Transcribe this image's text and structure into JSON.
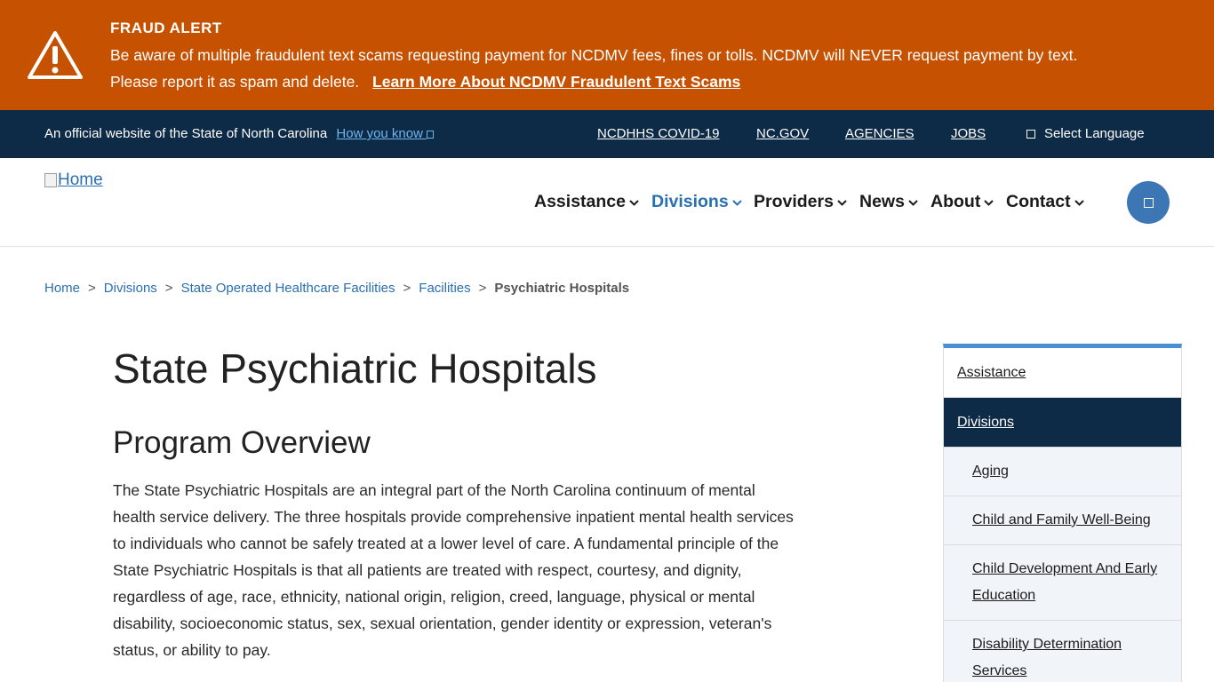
{
  "alert": {
    "title": "FRAUD ALERT",
    "message": "Be aware of multiple fraudulent text scams requesting payment for NCDMV fees, fines or tolls. NCDMV will NEVER request payment by text. Please report it as spam and delete.",
    "link": "Learn More About NCDMV Fraudulent Text Scams"
  },
  "topbar": {
    "official": "An official website of the State of North Carolina",
    "how_you_know": "How you know",
    "links": [
      "NCDHHS COVID-19",
      "NC.GOV",
      "AGENCIES",
      "JOBS"
    ],
    "language": "Select Language"
  },
  "header": {
    "logo_alt": "Home",
    "nav": [
      "Assistance",
      "Divisions",
      "Providers",
      "News",
      "About",
      "Contact"
    ],
    "active_nav": "Divisions"
  },
  "breadcrumb": {
    "items": [
      "Home",
      "Divisions",
      "State Operated Healthcare Facilities",
      "Facilities"
    ],
    "current": "Psychiatric Hospitals",
    "separator": ">"
  },
  "main": {
    "title": "State Psychiatric Hospitals",
    "section_title": "Program Overview",
    "paragraph": "The State Psychiatric Hospitals are an integral part of the North Carolina continuum of mental health service delivery. The three hospitals provide comprehensive inpatient mental health services to individuals who cannot be safely treated at a lower level of care. A fundamental principle of the State Psychiatric Hospitals is that all patients are treated with respect, courtesy, and dignity, regardless of age, race, ethnicity, national origin, religion, creed, language, physical or mental disability, socioeconomic status, sex, sexual orientation, gender identity or expression, veteran's status, or ability to pay."
  },
  "sidebar": {
    "top": "Assistance",
    "active": "Divisions",
    "children": [
      "Aging",
      "Child and Family Well-Being",
      "Child Development And Early Education",
      "Disability Determination Services"
    ]
  },
  "colors": {
    "alert_bg": "#c65100",
    "navy": "#0d2a47",
    "link_blue": "#2a6fb2",
    "sidebar_accent": "#4a8fd4",
    "search_button": "#3c76b5"
  },
  "icons": {
    "alert": "warning-triangle-icon",
    "search": "search-icon",
    "language": "globe-icon",
    "chevron": "chevron-down-icon"
  }
}
